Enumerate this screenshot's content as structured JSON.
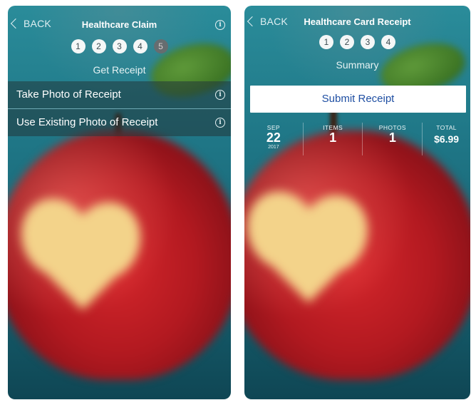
{
  "left_screen": {
    "back_label": "BACK",
    "title": "Healthcare Claim",
    "steps": [
      "1",
      "2",
      "3",
      "4",
      "5"
    ],
    "subtitle": "Get Receipt",
    "options": [
      "Take Photo of Receipt",
      "Use Existing Photo of Receipt"
    ]
  },
  "right_screen": {
    "back_label": "BACK",
    "title": "Healthcare Card Receipt",
    "steps": [
      "1",
      "2",
      "3",
      "4"
    ],
    "subtitle": "Summary",
    "submit_label": "Submit Receipt",
    "summary": {
      "date_month": "SEP",
      "date_day": "22",
      "date_year": "2017",
      "items_label": "ITEMS",
      "items_value": "1",
      "photos_label": "PHOTOS",
      "photos_value": "1",
      "total_label": "TOTAL",
      "total_value": "$6.99"
    }
  },
  "colors": {
    "accent_blue": "#1f4fa3",
    "teal_bg": "#1f7686",
    "apple_red": "#b21920",
    "heart_cream": "#f6d78b"
  },
  "icons": [
    "chevron-left-icon",
    "info-icon"
  ]
}
